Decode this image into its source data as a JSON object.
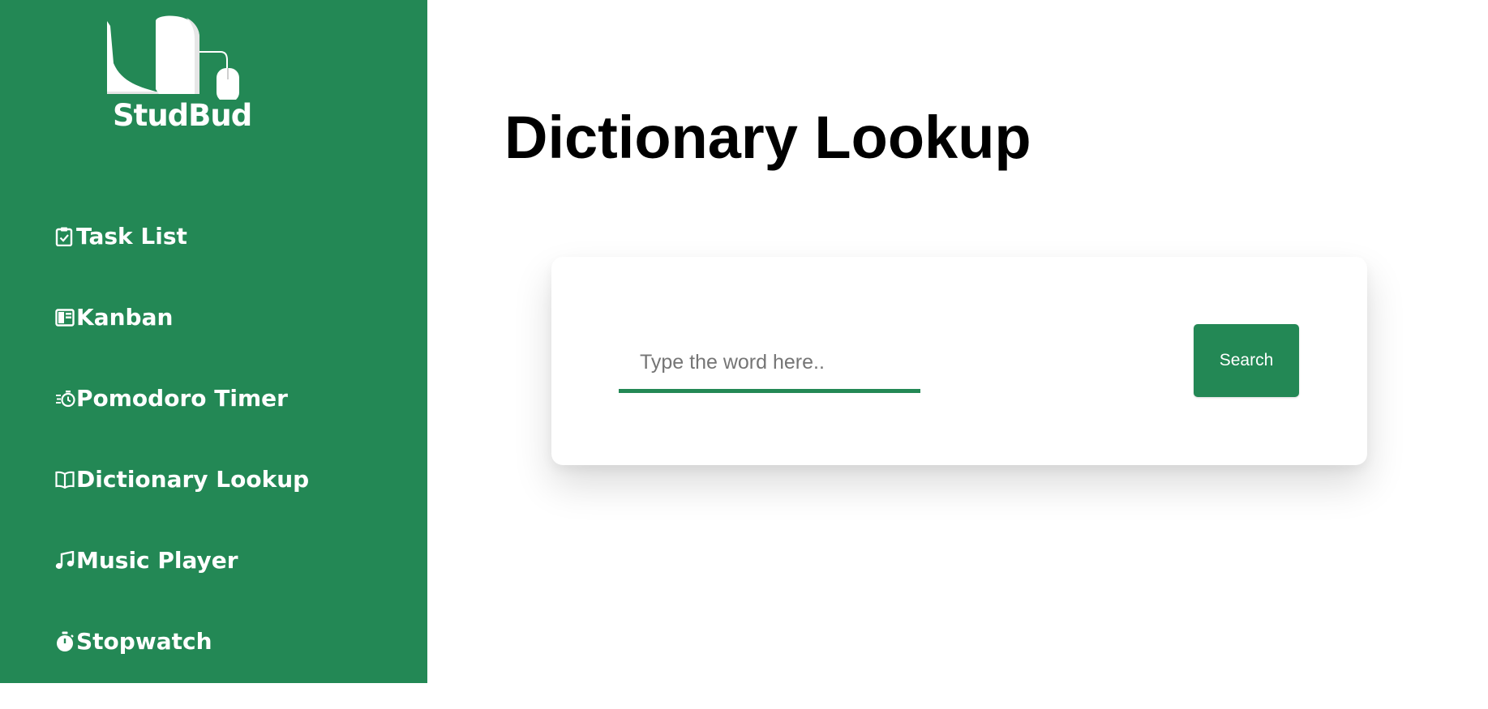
{
  "brand": {
    "name": "StudBud",
    "logo_icon": "book-mouse-icon"
  },
  "nav": {
    "items": [
      {
        "label": "Task List",
        "icon": "clipboard-check-icon"
      },
      {
        "label": "Kanban",
        "icon": "kanban-icon"
      },
      {
        "label": "Pomodoro Timer",
        "icon": "timer-icon"
      },
      {
        "label": "Dictionary Lookup",
        "icon": "book-open-icon"
      },
      {
        "label": "Music Player",
        "icon": "music-note-icon"
      },
      {
        "label": "Stopwatch",
        "icon": "stopwatch-icon"
      }
    ]
  },
  "main": {
    "title": "Dictionary Lookup",
    "search": {
      "placeholder": "Type the word here..",
      "value": "",
      "button_label": "Search"
    }
  },
  "colors": {
    "accent": "#238855",
    "sidebar_bg": "#238855",
    "text_on_accent": "#ffffff"
  }
}
